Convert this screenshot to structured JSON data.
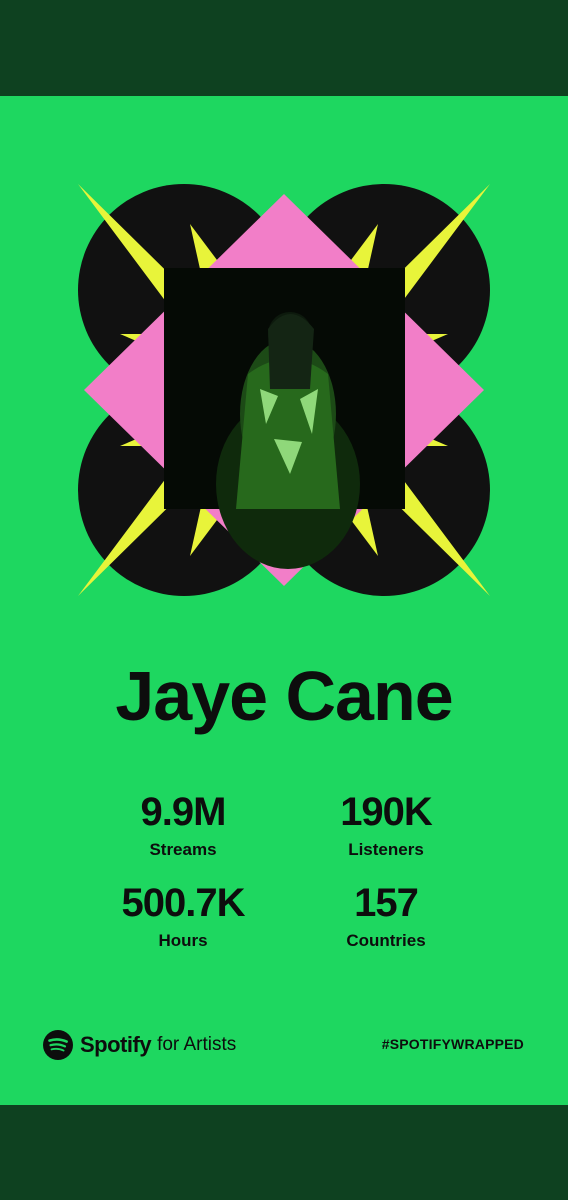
{
  "artist": {
    "name": "Jaye Cane"
  },
  "stats": [
    {
      "value": "9.9M",
      "label": "Streams"
    },
    {
      "value": "190K",
      "label": "Listeners"
    },
    {
      "value": "500.7K",
      "label": "Hours"
    },
    {
      "value": "157",
      "label": "Countries"
    }
  ],
  "footer": {
    "brand": "Spotify",
    "brand_sub": "for Artists",
    "hashtag": "#SPOTIFYWRAPPED"
  },
  "colors": {
    "background_green": "#1ed760",
    "frame_dark_green": "#0e4120",
    "burst_yellow": "#e8f43a",
    "diamond_pink": "#f27ec8",
    "circle_black": "#111111"
  },
  "icons": {
    "logo": "spotify-logo-icon"
  }
}
